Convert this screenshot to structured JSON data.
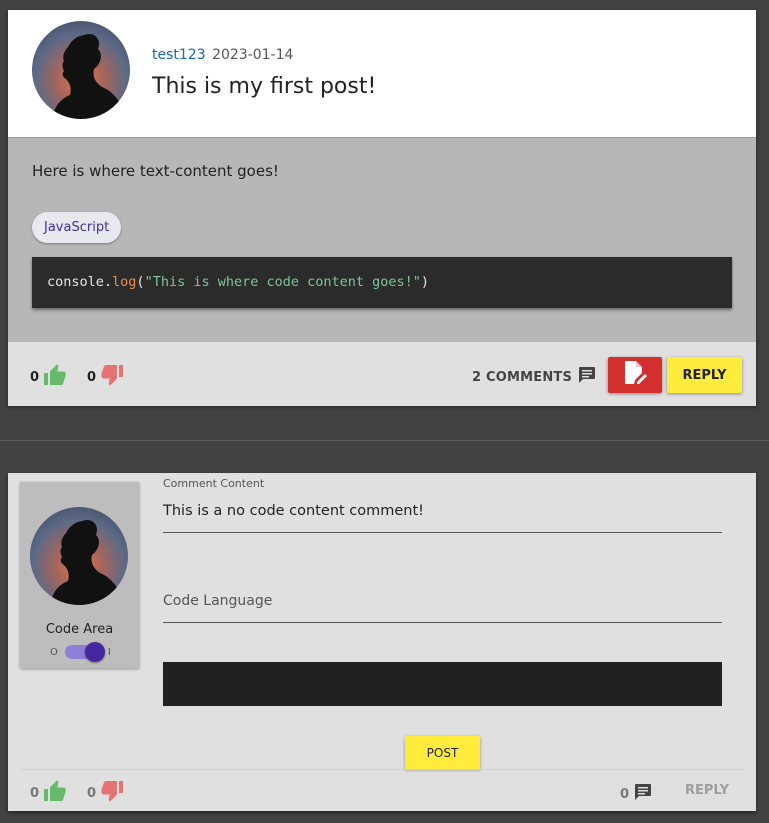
{
  "post": {
    "author": "test123",
    "date": "2023-01-14",
    "title": "This is my first post!",
    "text_content": "Here is where text-content goes!",
    "language_chip": "JavaScript",
    "code": {
      "prefix": "console.",
      "fn": "log",
      "open": "(",
      "string": "\"This is where code content goes!\"",
      "close": ")"
    },
    "likes": "0",
    "dislikes": "0",
    "comments_label": "2 COMMENTS",
    "reply_label": "REPLY",
    "icons": {
      "like": "thumbs-up-icon",
      "dislike": "thumbs-down-icon",
      "comment": "comment-icon",
      "edit": "edit-document-icon"
    },
    "colors": {
      "like": "#66bb6a",
      "dislike": "#e57373",
      "edit_button": "#d32f2f",
      "reply_button": "#ffeb3b",
      "author_link": "#1565c0"
    }
  },
  "comment_form": {
    "content_label": "Comment Content",
    "content_value": "This is a no code content comment!",
    "language_placeholder": "Code Language",
    "code_area_label": "Code Area",
    "toggle_off": "O",
    "toggle_on": "I",
    "toggle_state": "on",
    "post_label": "POST",
    "likes": "0",
    "dislikes": "0",
    "reply_count": "0",
    "reply_label": "REPLY"
  }
}
